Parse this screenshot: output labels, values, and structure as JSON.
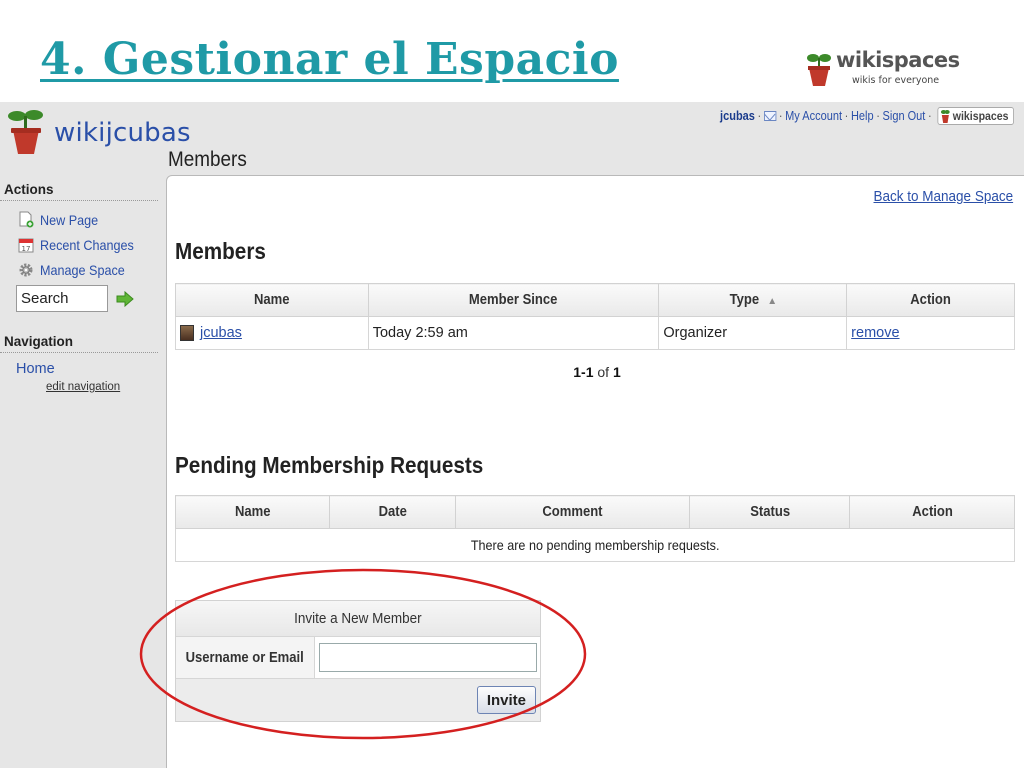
{
  "slide": {
    "title": "4. Gestionar el Espacio",
    "logo_name": "wikispaces",
    "logo_tagline": "wikis for everyone"
  },
  "site": {
    "name": "wikijcubas",
    "page_heading": "Members"
  },
  "topbar": {
    "user": "jcubas",
    "sep1": "·",
    "sep2": "·",
    "my_account": "My Account",
    "sep3": "·",
    "help": "Help",
    "sep4": "·",
    "sign_out": "Sign Out",
    "sep5": "·",
    "badge": "wikispaces"
  },
  "sidebar": {
    "actions_heading": "Actions",
    "items": [
      {
        "label": "New Page",
        "icon": "new-page-icon"
      },
      {
        "label": "Recent Changes",
        "icon": "calendar-icon"
      },
      {
        "label": "Manage Space",
        "icon": "gear-icon"
      }
    ],
    "search_value": "Search",
    "navigation_heading": "Navigation",
    "home": "Home",
    "edit_navigation": "edit navigation"
  },
  "main": {
    "back_link": "Back to Manage Space",
    "members_title": "Members",
    "members_table": {
      "headers": [
        "Name",
        "Member Since",
        "Type",
        "Action"
      ],
      "sort_indicator": "▲",
      "rows": [
        {
          "name": "jcubas",
          "since": "Today 2:59 am",
          "type": "Organizer",
          "action": "remove"
        }
      ]
    },
    "pager": {
      "range": "1-1",
      "of": "of",
      "total": "1"
    },
    "pending_title": "Pending Membership Requests",
    "pending_table": {
      "headers": [
        "Name",
        "Date",
        "Comment",
        "Status",
        "Action"
      ],
      "empty_message": "There are no pending membership requests."
    },
    "invite": {
      "heading": "Invite a New Member",
      "label": "Username or Email",
      "input_value": "",
      "button": "Invite"
    }
  },
  "colors": {
    "title_teal": "#1f9aa6",
    "link_blue": "#2a4fa8",
    "highlight_red": "#d42020"
  }
}
